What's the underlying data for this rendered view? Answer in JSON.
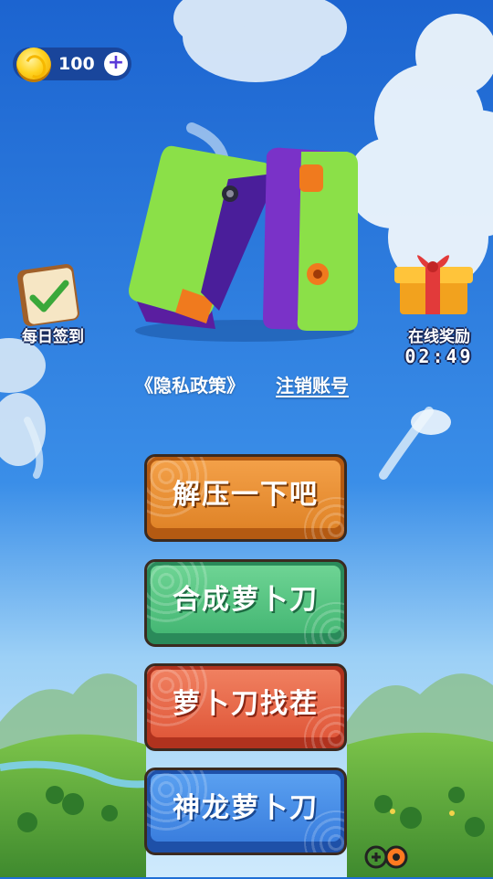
{
  "colors": {
    "sky_top": "#1c64d0",
    "sky_mid": "#3a8ee8",
    "grass": "#5aa83a",
    "knife_green": "#8be048",
    "knife_purple": "#7a32c8",
    "accent_orange": "#f07a1e"
  },
  "header": {
    "coins": "100",
    "coin_icon": "gold-coin-icon",
    "add_icon": "plus-icon",
    "add_glyph": "+"
  },
  "side": {
    "daily": {
      "label": "每日签到",
      "icon": "checklist-icon"
    },
    "online": {
      "label": "在线奖励",
      "timer": "02:49",
      "icon": "gift-box-icon"
    }
  },
  "links": {
    "privacy": "《隐私政策》",
    "cancel_account": "注销账号"
  },
  "menu": {
    "relax": "解压一下吧",
    "merge": "合成萝卜刀",
    "find_difference": "萝卜刀找茬",
    "dragon": "神龙萝卜刀"
  }
}
